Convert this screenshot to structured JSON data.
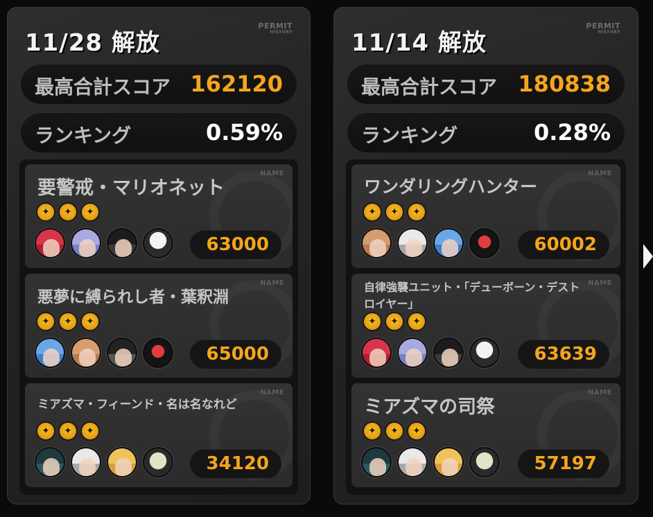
{
  "panels": [
    {
      "date": "11/28 解放",
      "permit": "PERMIT",
      "permit_sub": "HISTORY",
      "score_label": "最高合計スコア",
      "score_value": "162120",
      "rank_label": "ランキング",
      "rank_value": "0.59%",
      "stages": [
        {
          "name": "要警戒・マリオネット",
          "badge": "NAME",
          "stars": 3,
          "score": "63000",
          "team": [
            "av-red",
            "av-lav",
            "av-dark",
            "av-robot"
          ]
        },
        {
          "name": "悪夢に縛られし者・葉釈淵",
          "badge": "NAME",
          "stars": 3,
          "score": "65000",
          "team": [
            "av-blue",
            "av-tan",
            "av-black",
            "av-bot2"
          ]
        },
        {
          "name": "ミアズマ・フィーンド・名は名なれど",
          "badge": "NAME",
          "stars": 3,
          "score": "34120",
          "team": [
            "av-teal",
            "av-white",
            "av-blond",
            "av-panda"
          ]
        }
      ]
    },
    {
      "date": "11/14 解放",
      "permit": "PERMIT",
      "permit_sub": "HISTORY",
      "score_label": "最高合計スコア",
      "score_value": "180838",
      "rank_label": "ランキング",
      "rank_value": "0.28%",
      "stages": [
        {
          "name": "ワンダリングハンター",
          "badge": "NAME",
          "stars": 3,
          "score": "60002",
          "team": [
            "av-tan",
            "av-white",
            "av-blue",
            "av-bot2"
          ]
        },
        {
          "name": "自律強襲ユニット・「デューボーン・デストロイヤー」",
          "badge": "NAME",
          "stars": 3,
          "score": "63639",
          "team": [
            "av-red",
            "av-lav",
            "av-dark",
            "av-robot"
          ]
        },
        {
          "name": "ミアズマの司祭",
          "badge": "NAME",
          "stars": 3,
          "score": "57197",
          "team": [
            "av-teal",
            "av-white",
            "av-blond",
            "av-panda"
          ]
        }
      ]
    }
  ],
  "icons": {
    "star": "star-medal-icon",
    "next": "next-arrow-icon"
  },
  "colors": {
    "accent": "#f5a51c",
    "panel": "#262626",
    "card": "#2f2f2f"
  }
}
